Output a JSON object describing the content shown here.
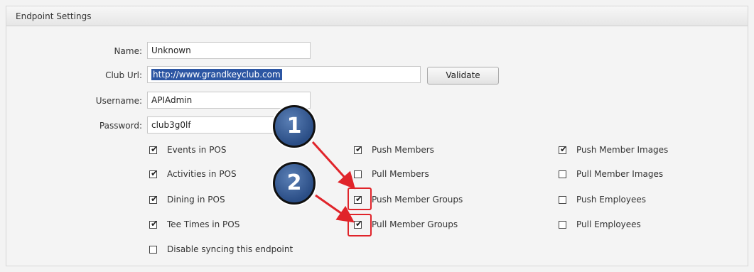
{
  "panel": {
    "title": "Endpoint Settings"
  },
  "form": {
    "name_label": "Name:",
    "name_value": "Unknown",
    "club_url_label": "Club Url:",
    "club_url_value": "http://www.grandkeyclub.com",
    "validate_label": "Validate",
    "username_label": "Username:",
    "username_value": "APIAdmin",
    "password_label": "Password:",
    "password_value": "club3g0lf"
  },
  "checkboxes": {
    "col1": [
      {
        "label": "Events in POS",
        "checked": true
      },
      {
        "label": "Activities in POS",
        "checked": true
      },
      {
        "label": "Dining in POS",
        "checked": true
      },
      {
        "label": "Tee Times in POS",
        "checked": true
      },
      {
        "label": "Disable syncing this endpoint",
        "checked": false
      }
    ],
    "col2": [
      {
        "label": "Push Members",
        "checked": true
      },
      {
        "label": "Pull Members",
        "checked": false
      },
      {
        "label": "Push Member Groups",
        "checked": true
      },
      {
        "label": "Pull Member Groups",
        "checked": true
      }
    ],
    "col3": [
      {
        "label": "Push Member Images",
        "checked": true
      },
      {
        "label": "Pull Member Images",
        "checked": false
      },
      {
        "label": "Push Employees",
        "checked": false
      },
      {
        "label": "Pull Employees",
        "checked": false
      }
    ]
  },
  "callouts": {
    "badge1": "1",
    "badge2": "2",
    "color": "#e0242a"
  }
}
